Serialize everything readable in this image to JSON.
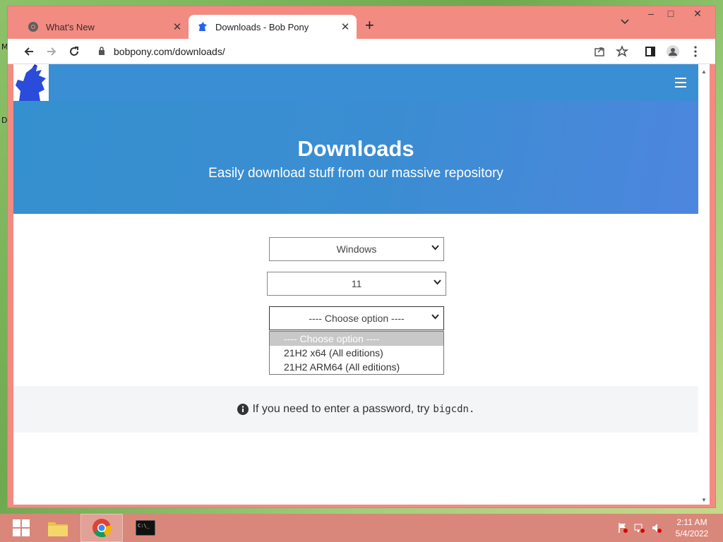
{
  "desktop": {
    "icon_letters": [
      "M",
      "D"
    ]
  },
  "browser": {
    "tabs": [
      {
        "title": "What's New",
        "active": false
      },
      {
        "title": "Downloads - Bob Pony",
        "active": true
      }
    ],
    "url": "bobpony.com/downloads/"
  },
  "page": {
    "hero_title": "Downloads",
    "hero_subtitle": "Easily download stuff from our massive repository",
    "os_select": "Windows",
    "version_select": "11",
    "option_select": "---- Choose option ----",
    "dropdown_options": [
      "---- Choose option ----",
      "21H2 x64 (All editions)",
      "21H2 ARM64 (All editions)"
    ],
    "info_text": "If you need to enter a password, try",
    "info_password": "bigcdn."
  },
  "taskbar": {
    "time": "2:11 AM",
    "date": "5/4/2022"
  },
  "colors": {
    "window_frame": "#f28b82",
    "hero": "#3b8dd2",
    "taskbar": "#d9877a"
  }
}
